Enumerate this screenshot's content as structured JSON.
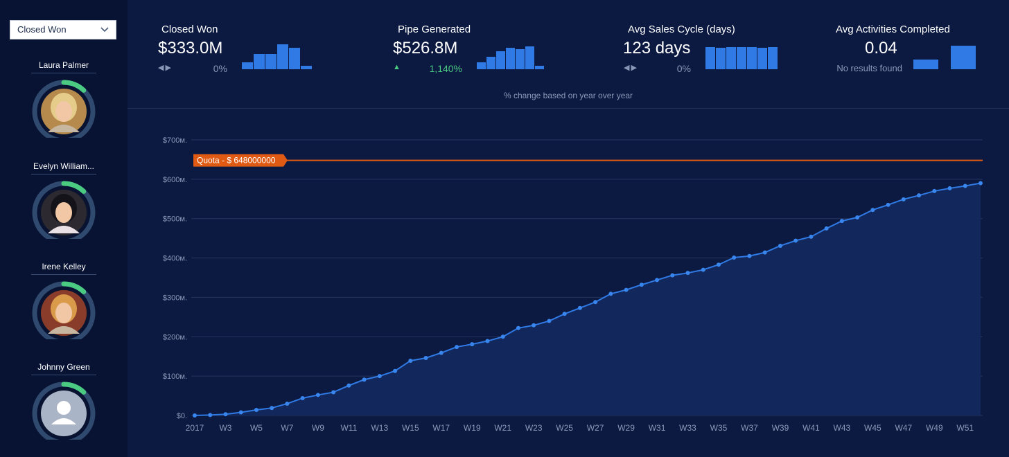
{
  "sidebar": {
    "filter": {
      "selected": "Closed Won"
    },
    "people": [
      {
        "name": "Laura Palmer",
        "progress": 0.12
      },
      {
        "name": "Evelyn William...",
        "progress": 0.12
      },
      {
        "name": "Irene Kelley",
        "progress": 0.12
      },
      {
        "name": "Johnny Green",
        "progress": 0.12
      }
    ]
  },
  "kpis": [
    {
      "title": "Closed Won",
      "value": "$333.0M",
      "change": "0%",
      "trend": "neutral",
      "spark": [
        10,
        22,
        22,
        36,
        31,
        5
      ]
    },
    {
      "title": "Pipe Generated",
      "value": "$526.8M",
      "change": "1,140%",
      "trend": "up",
      "spark": [
        10,
        18,
        26,
        31,
        29,
        33,
        5
      ]
    },
    {
      "title": "Avg Sales Cycle (days)",
      "value": "123 days",
      "change": "0%",
      "trend": "neutral",
      "spark": [
        32,
        31,
        32,
        32,
        32,
        31,
        32
      ]
    },
    {
      "title": "Avg Activities Completed",
      "value": "0.04",
      "change": "No results found",
      "trend": "none",
      "spark": [
        14,
        34
      ]
    }
  ],
  "yoy_note": "% change based on year over year",
  "colors": {
    "accent": "#2f7ae5",
    "quota": "#e05a13",
    "positive": "#4bca81",
    "ring_track": "#2f4a6e",
    "ring_progress": "#4bca81"
  },
  "chart_data": {
    "type": "area",
    "x": [
      "2017",
      "W2",
      "W3",
      "W4",
      "W5",
      "W6",
      "W7",
      "W8",
      "W9",
      "W10",
      "W11",
      "W12",
      "W13",
      "W14",
      "W15",
      "W16",
      "W17",
      "W18",
      "W19",
      "W20",
      "W21",
      "W22",
      "W23",
      "W24",
      "W25",
      "W26",
      "W27",
      "W28",
      "W29",
      "W30",
      "W31",
      "W32",
      "W33",
      "W34",
      "W35",
      "W36",
      "W37",
      "W38",
      "W39",
      "W40",
      "W41",
      "W42",
      "W43",
      "W44",
      "W45",
      "W46",
      "W47",
      "W48",
      "W49",
      "W50",
      "W51",
      "W52"
    ],
    "tick_labels": [
      "2017",
      "W3",
      "W5",
      "W7",
      "W9",
      "W11",
      "W13",
      "W15",
      "W17",
      "W19",
      "W21",
      "W23",
      "W25",
      "W27",
      "W29",
      "W31",
      "W33",
      "W35",
      "W37",
      "W39",
      "W41",
      "W43",
      "W45",
      "W47",
      "W49",
      "W51"
    ],
    "y_ticks": [
      "$0.",
      "$100м.",
      "$200м.",
      "$300м.",
      "$400м.",
      "$500м.",
      "$600м.",
      "$700м."
    ],
    "ylim": [
      0,
      700
    ],
    "values": [
      0,
      1,
      3,
      8,
      14,
      19,
      30,
      44,
      52,
      59,
      76,
      91,
      100,
      113,
      139,
      146,
      159,
      174,
      181,
      189,
      200,
      222,
      229,
      240,
      258,
      273,
      288,
      309,
      319,
      332,
      344,
      356,
      362,
      370,
      383,
      401,
      405,
      414,
      431,
      444,
      454,
      475,
      494,
      503,
      522,
      535,
      549,
      559,
      570,
      577,
      583,
      590
    ],
    "quota": {
      "value": 648,
      "label": "Quota - $ 648000000"
    }
  }
}
